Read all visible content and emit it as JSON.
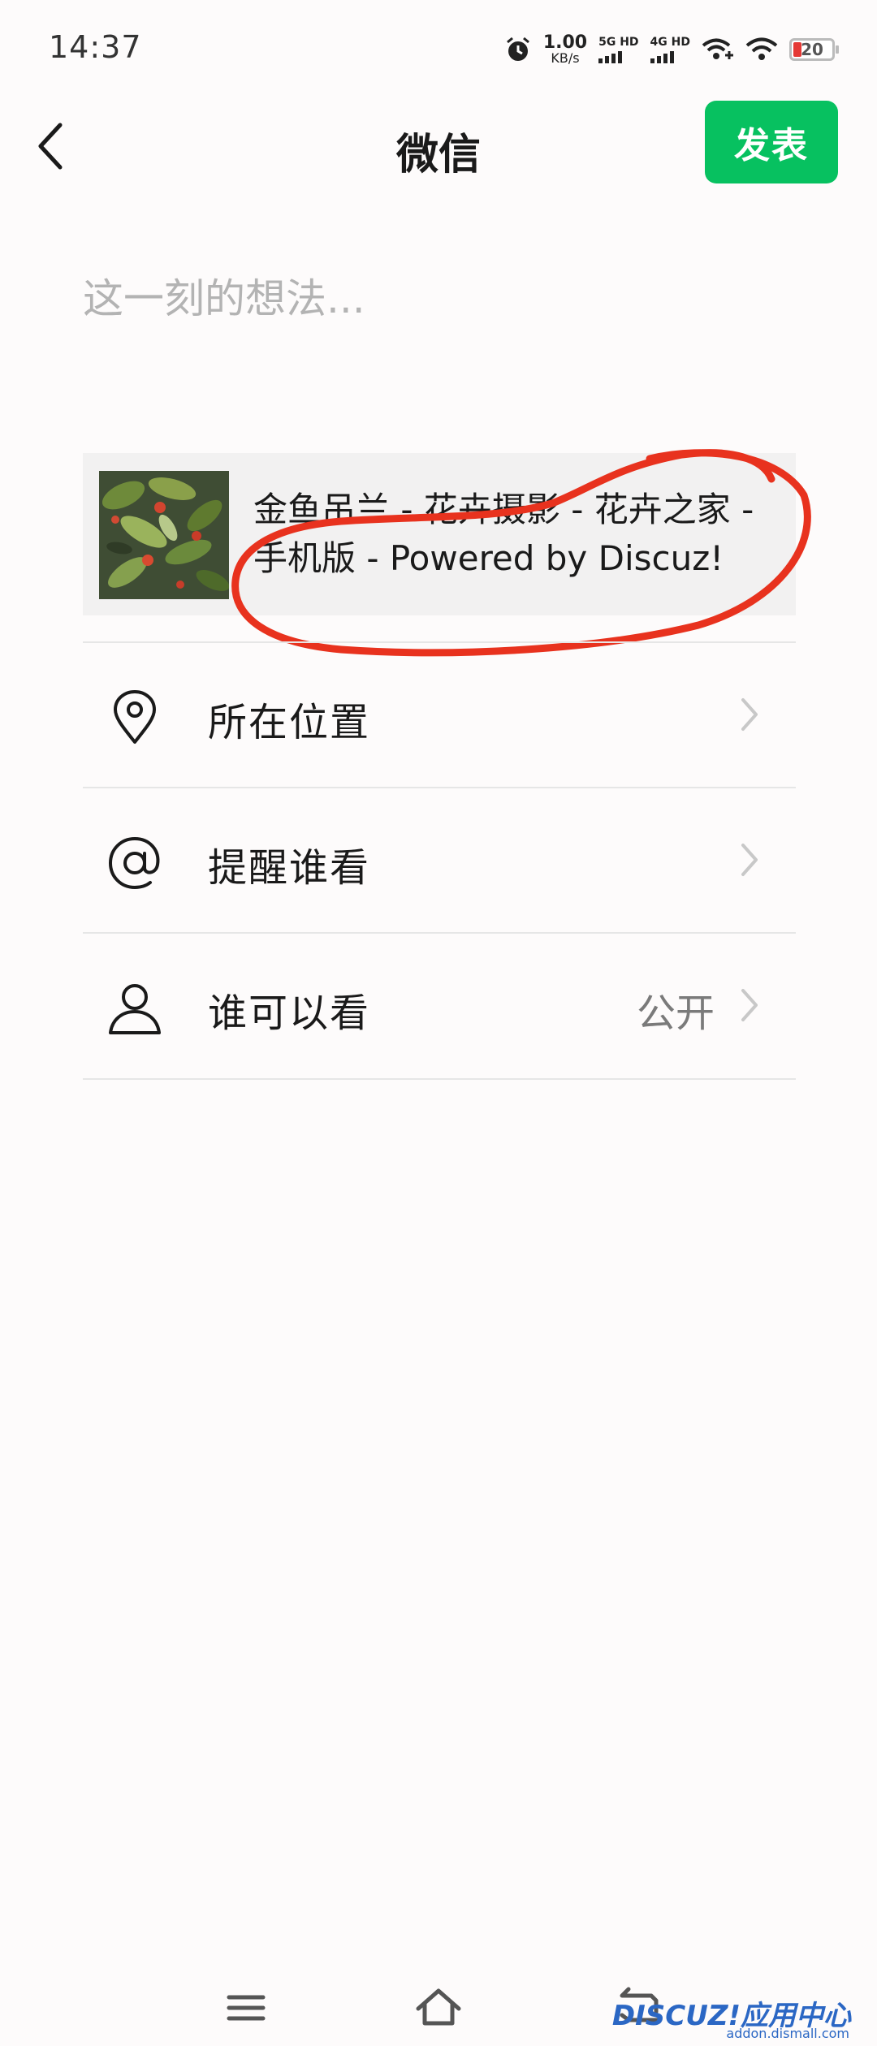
{
  "status_bar": {
    "time": "14:37",
    "speed_value": "1.00",
    "speed_unit": "KB/s",
    "net1": "5G HD",
    "net2": "4G HD",
    "battery": "20"
  },
  "header": {
    "title": "微信",
    "publish_label": "发表"
  },
  "compose": {
    "placeholder": "这一刻的想法..."
  },
  "shared_link": {
    "title_line1": "金鱼吊兰 - 花卉摄影 - 花卉之家 -",
    "title_line2": "手机版 - Powered by Discuz!"
  },
  "options": [
    {
      "label": "所在位置",
      "icon": "location-pin-icon",
      "value": ""
    },
    {
      "label": "提醒谁看",
      "icon": "at-sign-icon",
      "value": ""
    },
    {
      "label": "谁可以看",
      "icon": "person-icon",
      "value": "公开"
    }
  ],
  "watermark": {
    "brand": "DISCUZ!应用中心",
    "url": "addon.dismall.com"
  },
  "colors": {
    "accent": "#07c160",
    "annotation": "#e8321e"
  }
}
